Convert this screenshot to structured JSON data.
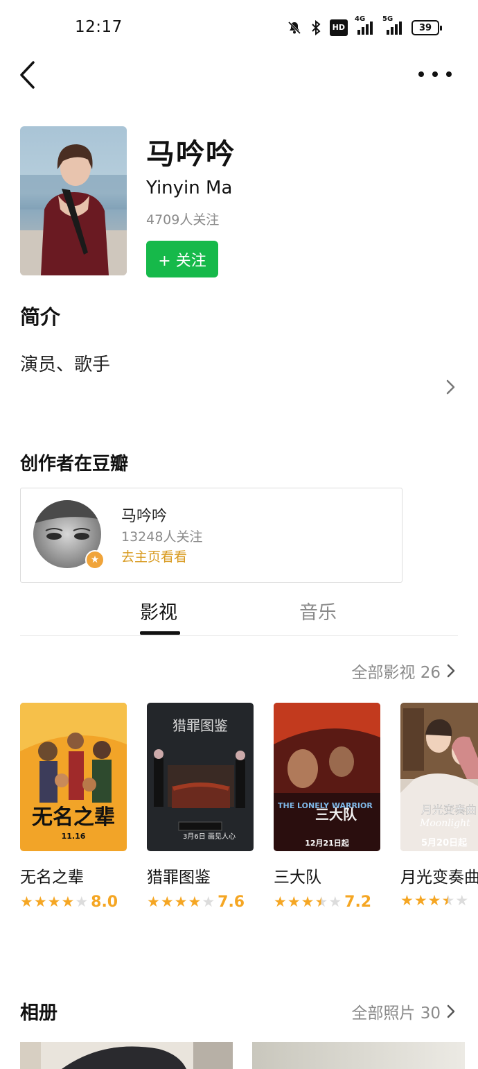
{
  "status_bar": {
    "time": "12:17",
    "hd": "HD",
    "net_4g": "4G",
    "net_5g": "5G",
    "battery": "39"
  },
  "profile": {
    "name_cn": "马吟吟",
    "name_en": "Yinyin Ma",
    "followers": "4709人关注",
    "follow_button": "+ 关注"
  },
  "intro": {
    "title": "简介",
    "text": "演员、歌手"
  },
  "creator": {
    "title": "创作者在豆瓣",
    "name": "马吟吟",
    "followers": "13248人关注",
    "link": "去主页看看"
  },
  "tabs": [
    {
      "label": "影视",
      "active": true
    },
    {
      "label": "音乐",
      "active": false
    }
  ],
  "movies_section": {
    "all_label": "全部影视 26",
    "movies": [
      {
        "title": "无名之辈",
        "score": "8.0",
        "stars": 4.0
      },
      {
        "title": "猎罪图鉴",
        "score": "7.6",
        "stars": 4.0
      },
      {
        "title": "三大队",
        "score": "7.2",
        "stars": 3.5
      },
      {
        "title": "月光变奏曲",
        "score": "",
        "stars": 3.5
      }
    ],
    "poster_texts": {
      "p1_title": "无名之辈",
      "p1_date": "11.16",
      "p2_title": "猎罪图鉴",
      "p2_date": "3月6日",
      "p2_tag": "画见人心",
      "p3_en": "THE LONELY WARRIOR",
      "p3_title": "三大队",
      "p3_date": "12月21日起",
      "p4_title": "月光变奏曲",
      "p4_en": "Moonlight",
      "p4_date": "5月20日起"
    }
  },
  "album": {
    "title": "相册",
    "all_label": "全部照片 30"
  },
  "colors": {
    "follow_green": "#16b94a",
    "star_orange": "#f5a623",
    "link_gold": "#d89a1f",
    "muted_gray": "#8a8a8a"
  }
}
